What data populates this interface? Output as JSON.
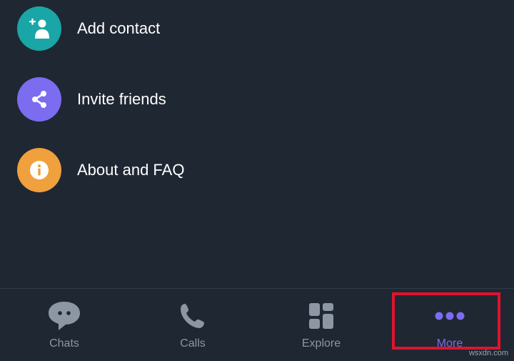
{
  "menu": {
    "items": [
      {
        "label": "Add contact",
        "icon": "add-contact-icon",
        "color": "#1aa6a6"
      },
      {
        "label": "Invite friends",
        "icon": "share-icon",
        "color": "#7b6cf0"
      },
      {
        "label": "About and FAQ",
        "icon": "info-icon",
        "color": "#f0a03c"
      }
    ]
  },
  "bottom_nav": {
    "tabs": [
      {
        "label": "Chats",
        "icon": "chat-bubble-icon"
      },
      {
        "label": "Calls",
        "icon": "phone-icon"
      },
      {
        "label": "Explore",
        "icon": "explore-grid-icon"
      },
      {
        "label": "More",
        "icon": "more-dots-icon",
        "active": true
      }
    ]
  },
  "colors": {
    "background": "#1f2733",
    "accent": "#7b6cf0",
    "inactive": "#8d96a3",
    "highlight": "#e0142c"
  },
  "watermark": "wsxdn.com"
}
